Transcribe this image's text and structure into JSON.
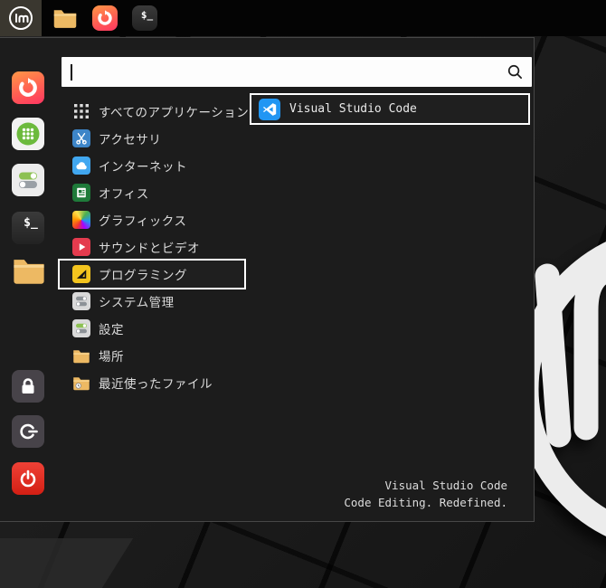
{
  "colors": {
    "panel_bg": "#040404",
    "menu_bg": "#1c1c1c",
    "menu_border": "#474747",
    "selection_border": "#ffffff",
    "search_bg": "#fdfdfd",
    "text": "#dcdcdc",
    "vscode_blue": "#2196f3",
    "power_red": "#e2342b",
    "folder_orange": "#edb963",
    "browser_gradient": [
      "#ff9847",
      "#ff3562"
    ],
    "software_manager_green": "#6cba3d",
    "programming_yellow": "#f3c41e"
  },
  "panel": {
    "menu_button": {
      "icon": "mint-logo-icon",
      "label": "lm"
    },
    "launchers": [
      {
        "name": "files",
        "icon": "folder-icon"
      },
      {
        "name": "web-browser",
        "icon": "browser-swirl-icon"
      },
      {
        "name": "terminal",
        "icon": "terminal-icon",
        "glyph": "$_"
      }
    ]
  },
  "menu": {
    "search": {
      "value": "",
      "placeholder": ""
    },
    "sidebar": [
      {
        "name": "web-browser",
        "icon": "browser-swirl-icon"
      },
      {
        "name": "software-manager",
        "icon": "dots-grid-circle-icon"
      },
      {
        "name": "system-settings",
        "icon": "toggles-icon"
      },
      {
        "name": "terminal",
        "icon": "terminal-icon",
        "glyph": "$_"
      },
      {
        "name": "files",
        "icon": "folder-icon"
      },
      {
        "name": "lock-screen",
        "icon": "padlock-icon"
      },
      {
        "name": "logout",
        "icon": "logout-icon"
      },
      {
        "name": "shutdown",
        "icon": "power-icon"
      }
    ],
    "categories": [
      {
        "label": "すべてのアプリケーション",
        "icon": "grid-icon",
        "selected": false
      },
      {
        "label": "アクセサリ",
        "icon": "scissors-icon",
        "selected": false
      },
      {
        "label": "インターネット",
        "icon": "cloud-icon",
        "selected": false
      },
      {
        "label": "オフィス",
        "icon": "document-icon",
        "selected": false
      },
      {
        "label": "グラフィックス",
        "icon": "rainbow-icon",
        "selected": false
      },
      {
        "label": "サウンドとビデオ",
        "icon": "play-icon",
        "selected": false
      },
      {
        "label": "プログラミング",
        "icon": "set-square-icon",
        "selected": true
      },
      {
        "label": "システム管理",
        "icon": "toggles-grey-icon",
        "selected": false
      },
      {
        "label": "設定",
        "icon": "toggles-icon",
        "selected": false
      },
      {
        "label": "場所",
        "icon": "folder-icon",
        "selected": false
      },
      {
        "label": "最近使ったファイル",
        "icon": "folder-clock-icon",
        "selected": false
      }
    ],
    "apps": [
      {
        "label": "Visual Studio Code",
        "icon": "vscode-icon",
        "selected": true
      }
    ],
    "selected_app_info": {
      "name": "Visual Studio Code",
      "tagline": "Code Editing. Redefined."
    }
  }
}
